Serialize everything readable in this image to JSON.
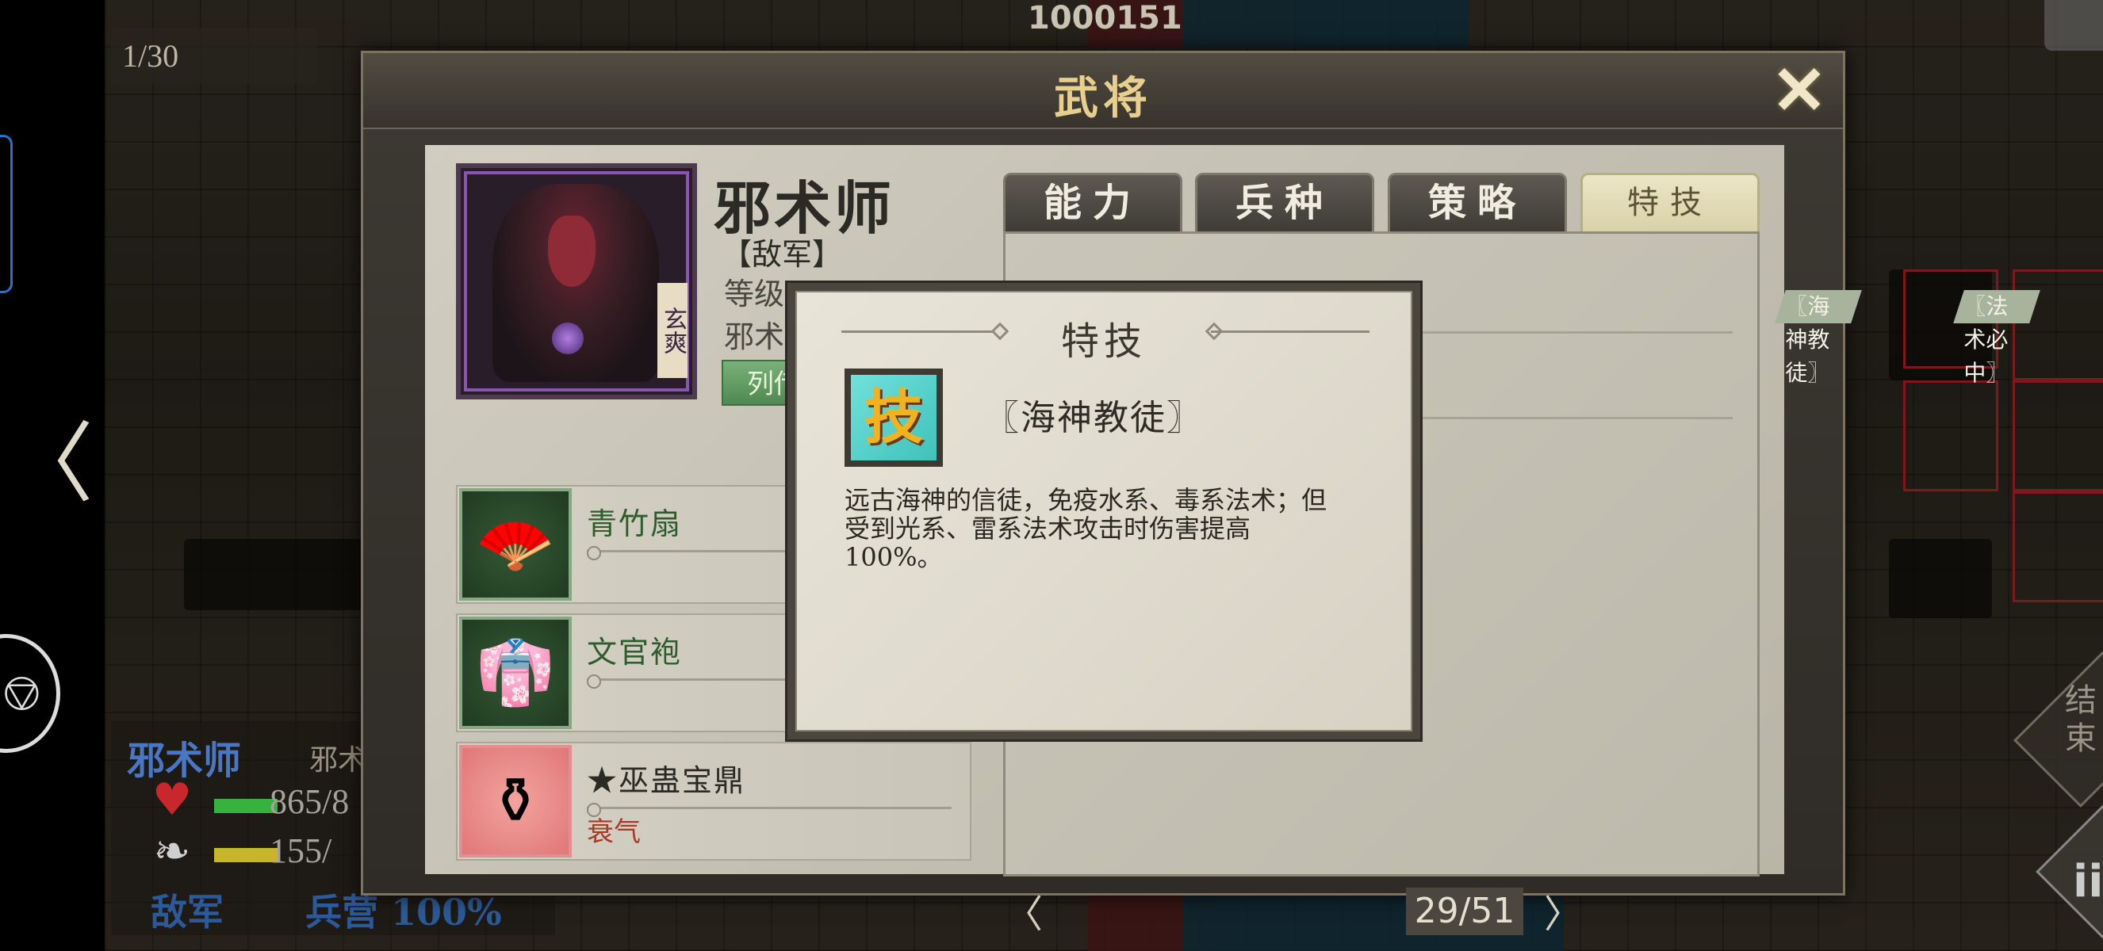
{
  "hud": {
    "turn_counter": "1/30",
    "top_number": "1000151",
    "end_turn_label": "结束",
    "info_label": "ii"
  },
  "unit_status": {
    "name": "邪术师",
    "class": "邪术",
    "hp": "865/8",
    "mp": "155/",
    "faction": "敌军",
    "base": "兵营 100%"
  },
  "dialog": {
    "title": "武将",
    "close_symbol": "✕",
    "prev_symbol": "〈",
    "next_symbol": "〉"
  },
  "hero": {
    "name": "邪术师",
    "faction": "【敌军】",
    "level_label": "等级",
    "class_label": "邪术",
    "portrait_tag": "玄爽",
    "bio_button": "列传"
  },
  "tabs": [
    "能力",
    "兵种",
    "策略",
    "特技"
  ],
  "active_tab": "特技",
  "skill_chips": [
    "〖海神教徒〗",
    "〖法术必中〗"
  ],
  "equipment": [
    {
      "name": "青竹扇",
      "icon": "fan-icon",
      "glyph": "🪭",
      "effect": ""
    },
    {
      "name": "文官袍",
      "icon": "robe-icon",
      "glyph": "👘",
      "effect": ""
    },
    {
      "name": "★巫蛊宝鼎",
      "icon": "cauldron-icon",
      "glyph": "⚱",
      "effect": "衰气"
    }
  ],
  "pager": {
    "prev": "〈",
    "text": "29/51",
    "next": "〉"
  },
  "popup": {
    "title": "特技",
    "skill_icon_char": "技",
    "skill_name": "〖海神教徒〗",
    "description": "远古海神的信徒，免疫水系、毒系法术；但受到光系、雷系法术攻击时伤害提高100%。"
  },
  "colors": {
    "accent_gold": "#e8cf8e",
    "enemy_blue": "#4a77c4",
    "hp_green": "#38b23e",
    "mp_yellow": "#c9b52c",
    "skill_teal": "#3fc2bb"
  }
}
